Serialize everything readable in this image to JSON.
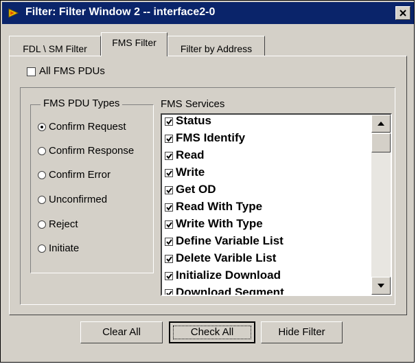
{
  "window": {
    "title": "Filter: Filter Window 2 -- interface2-0",
    "colors": {
      "titlebar": "#0a246a",
      "face": "#d4d0c8"
    }
  },
  "tabs": [
    {
      "label": "FDL \\ SM Filter",
      "active": false
    },
    {
      "label": "FMS Filter",
      "active": true
    },
    {
      "label": "Filter by Address",
      "active": false
    }
  ],
  "all_pdus": {
    "label": "All FMS PDUs",
    "checked": false
  },
  "pdu_types": {
    "title": "FMS PDU Types",
    "options": [
      {
        "label": "Confirm Request",
        "checked": true
      },
      {
        "label": "Confirm Response",
        "checked": false
      },
      {
        "label": "Confirm Error",
        "checked": false
      },
      {
        "label": "Unconfirmed",
        "checked": false
      },
      {
        "label": "Reject",
        "checked": false
      },
      {
        "label": "Initiate",
        "checked": false
      }
    ]
  },
  "services": {
    "title": "FMS Services",
    "items": [
      {
        "label": "Status",
        "checked": true
      },
      {
        "label": "FMS Identify",
        "checked": true
      },
      {
        "label": "Read",
        "checked": true
      },
      {
        "label": "Write",
        "checked": true
      },
      {
        "label": "Get OD",
        "checked": true
      },
      {
        "label": "Read With Type",
        "checked": true
      },
      {
        "label": "Write With Type",
        "checked": true
      },
      {
        "label": "Define Variable List",
        "checked": true
      },
      {
        "label": "Delete Varible List",
        "checked": true
      },
      {
        "label": "Initialize Download",
        "checked": true
      },
      {
        "label": "Download Segment",
        "checked": true
      }
    ]
  },
  "buttons": {
    "clear_all": "Clear All",
    "check_all": "Check All",
    "hide_filter": "Hide Filter"
  }
}
